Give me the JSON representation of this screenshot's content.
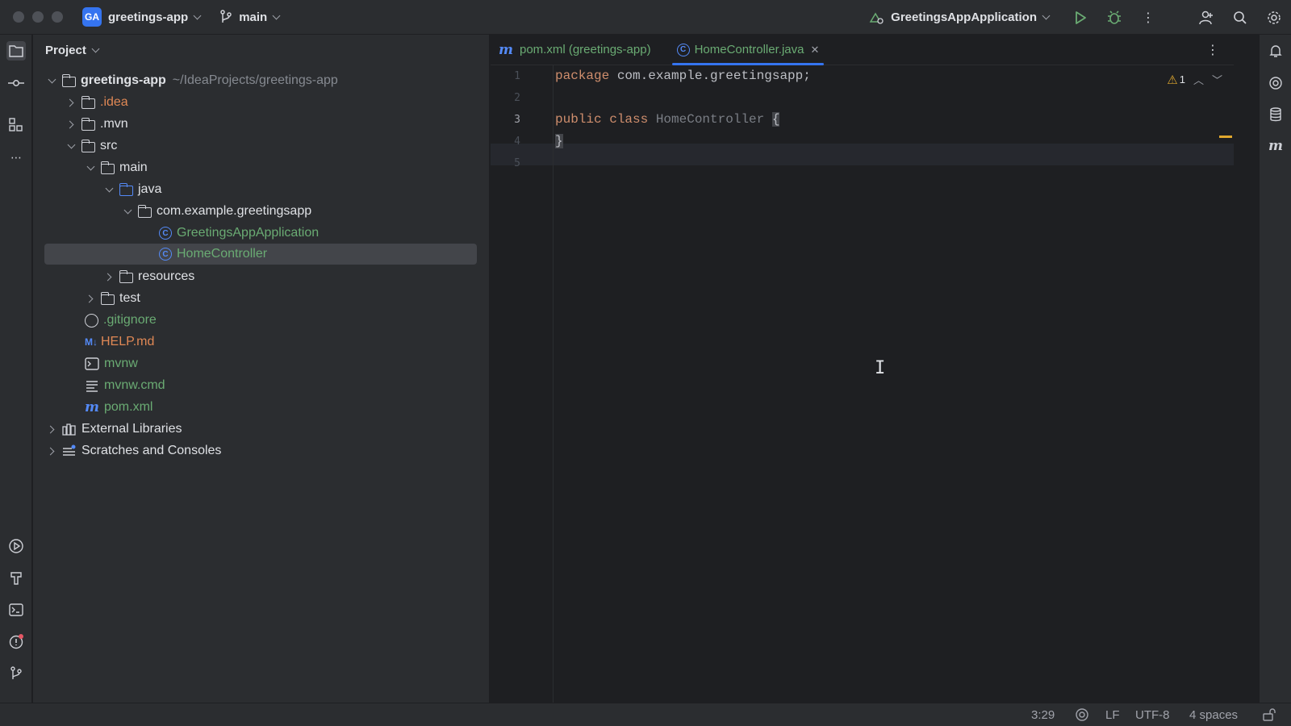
{
  "titlebar": {
    "project_badge": "GA",
    "project_name": "greetings-app",
    "branch": "main",
    "run_config": "GreetingsAppApplication",
    "icons": [
      "branch-icon",
      "run-config-icon",
      "run-icon",
      "debug-icon",
      "more-icon",
      "add-user-icon",
      "search-icon",
      "settings-icon"
    ]
  },
  "left_toolbar": [
    "project-icon",
    "commit-icon",
    "structure-icon",
    "more-icon",
    "run-icon",
    "build-icon",
    "terminal-icon",
    "problems-icon",
    "git-icon"
  ],
  "right_toolbar": [
    "notifications-icon",
    "ai-assistant-icon",
    "database-icon",
    "maven-icon"
  ],
  "project_panel": {
    "title": "Project",
    "tree": [
      {
        "label": "greetings-app",
        "path": "~/IdeaProjects/greetings-app"
      },
      {
        "label": ".idea"
      },
      {
        "label": ".mvn"
      },
      {
        "label": "src"
      },
      {
        "label": "main"
      },
      {
        "label": "java"
      },
      {
        "label": "com.example.greetingsapp"
      },
      {
        "label": "GreetingsAppApplication"
      },
      {
        "label": "HomeController"
      },
      {
        "label": "resources"
      },
      {
        "label": "test"
      },
      {
        "label": ".gitignore"
      },
      {
        "label": "HELP.md"
      },
      {
        "label": "mvnw"
      },
      {
        "label": "mvnw.cmd"
      },
      {
        "label": "pom.xml"
      },
      {
        "label": "External Libraries"
      },
      {
        "label": "Scratches and Consoles"
      }
    ]
  },
  "editor": {
    "tabs": [
      {
        "label": "pom.xml (greetings-app)",
        "icon": "m"
      },
      {
        "label": "HomeController.java",
        "icon": "C",
        "active": true
      }
    ],
    "line_numbers": [
      "1",
      "2",
      "3",
      "4",
      "5"
    ],
    "code": {
      "l1_kw": "package",
      "l1_rest": " com.example.greetingsapp;",
      "l3_kw": "public class",
      "l3_cls": " HomeController ",
      "l3_brace": "{",
      "l4_brace": "}"
    },
    "warning_count": "1"
  },
  "statusbar": {
    "position": "3:29",
    "line_sep": "LF",
    "encoding": "UTF-8",
    "indent": "4 spaces"
  }
}
